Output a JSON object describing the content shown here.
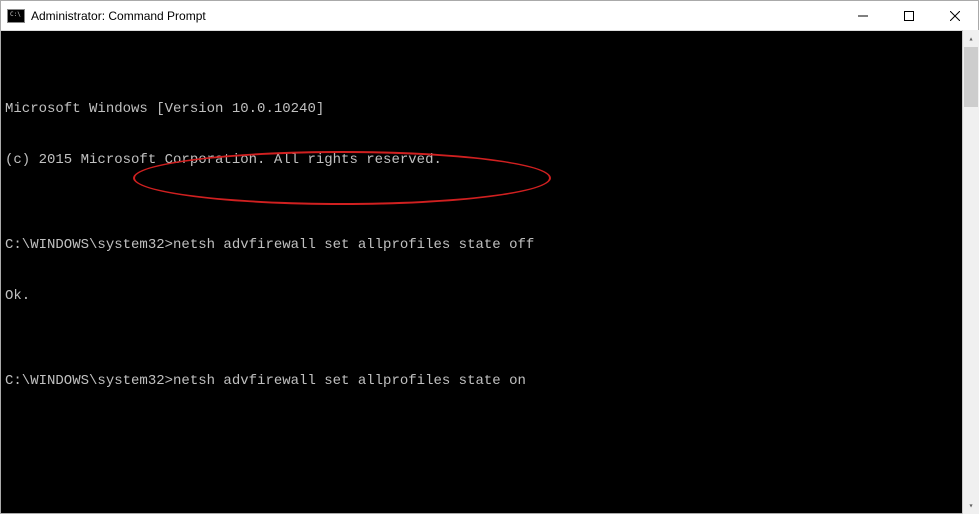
{
  "window": {
    "title": "Administrator: Command Prompt"
  },
  "terminal": {
    "lines": [
      "Microsoft Windows [Version 10.0.10240]",
      "(c) 2015 Microsoft Corporation. All rights reserved.",
      "",
      "C:\\WINDOWS\\system32>netsh advfirewall set allprofiles state off",
      "Ok.",
      "",
      "C:\\WINDOWS\\system32>netsh advfirewall set allprofiles state on"
    ]
  },
  "annotation": {
    "type": "ellipse",
    "color": "#d02020",
    "target_line_index": 6,
    "purpose": "highlight command"
  }
}
